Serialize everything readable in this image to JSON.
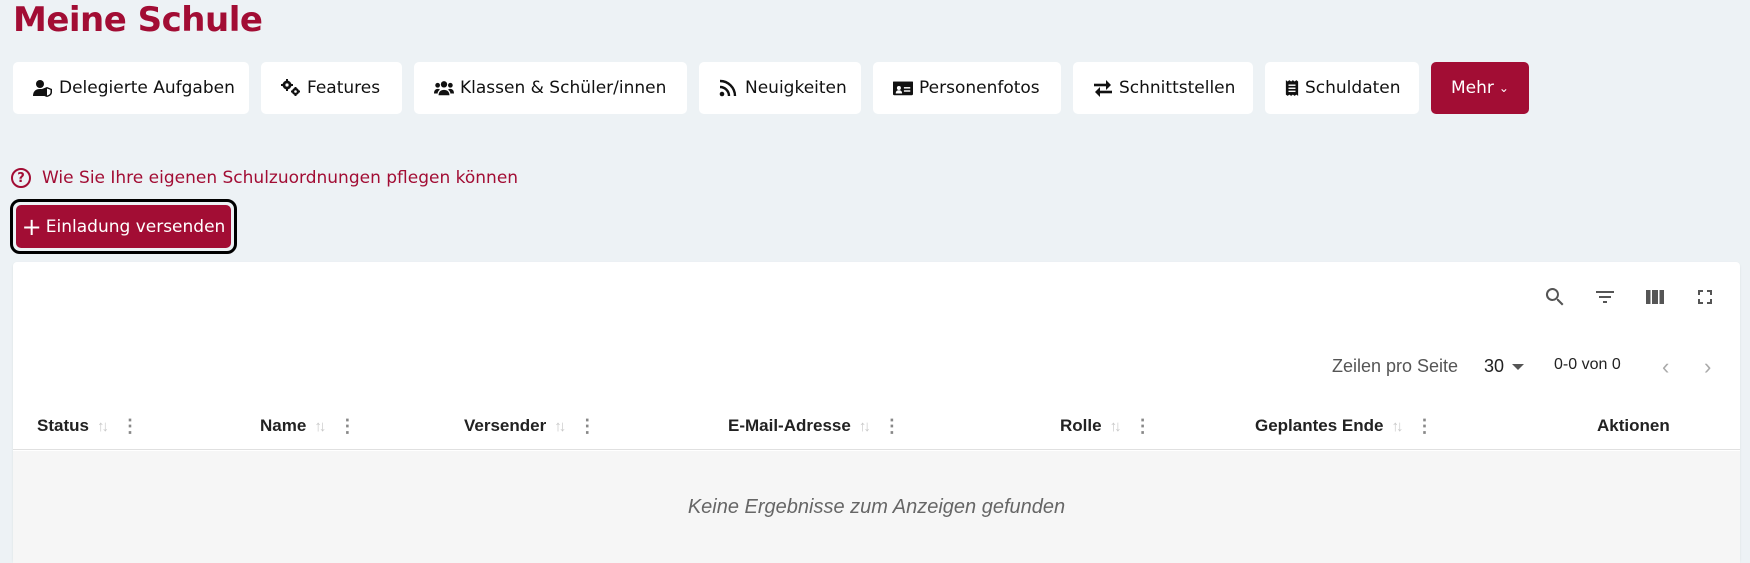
{
  "page_title": "Meine Schule",
  "nav": {
    "items": [
      {
        "label": "Delegierte Aufgaben",
        "icon": "user-shield-icon"
      },
      {
        "label": "Features",
        "icon": "gears-icon"
      },
      {
        "label": "Klassen & Schüler/innen",
        "icon": "users-icon"
      },
      {
        "label": "Neuigkeiten",
        "icon": "rss-icon"
      },
      {
        "label": "Personenfotos",
        "icon": "id-card-icon"
      },
      {
        "label": "Schnittstellen",
        "icon": "exchange-icon"
      },
      {
        "label": "Schuldaten",
        "icon": "receipt-icon"
      }
    ],
    "more_label": "Mehr"
  },
  "help_link": "Wie Sie Ihre eigenen Schulzuordnungen pflegen können",
  "invite_button": "Einladung versenden",
  "table": {
    "rows_per_page_label": "Zeilen pro Seite",
    "rows_per_page_value": "30",
    "range": "0-0 von 0",
    "columns": [
      "Status",
      "Name",
      "Versender",
      "E-Mail-Adresse",
      "Rolle",
      "Geplantes Ende",
      "Aktionen"
    ],
    "empty_message": "Keine Ergebnisse zum Anzeigen gefunden"
  },
  "colors": {
    "brand": "#a20d34",
    "background": "#edf2f5"
  }
}
